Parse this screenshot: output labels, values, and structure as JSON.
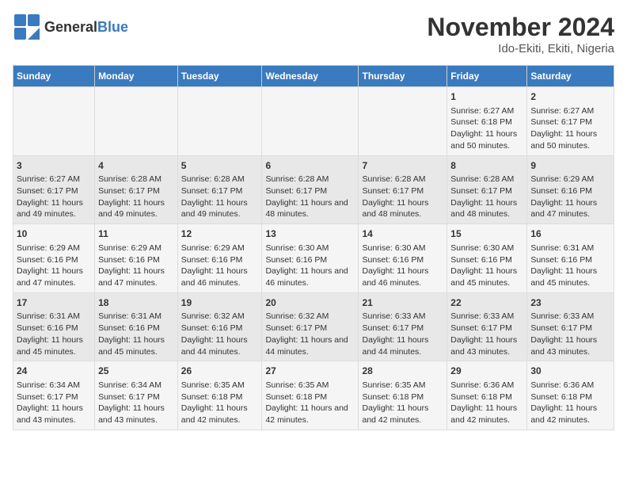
{
  "header": {
    "logo_general": "General",
    "logo_blue": "Blue",
    "title": "November 2024",
    "subtitle": "Ido-Ekiti, Ekiti, Nigeria"
  },
  "days_of_week": [
    "Sunday",
    "Monday",
    "Tuesday",
    "Wednesday",
    "Thursday",
    "Friday",
    "Saturday"
  ],
  "weeks": [
    {
      "cells": [
        {
          "day": "",
          "detail": ""
        },
        {
          "day": "",
          "detail": ""
        },
        {
          "day": "",
          "detail": ""
        },
        {
          "day": "",
          "detail": ""
        },
        {
          "day": "",
          "detail": ""
        },
        {
          "day": "1",
          "detail": "Sunrise: 6:27 AM\nSunset: 6:18 PM\nDaylight: 11 hours and 50 minutes."
        },
        {
          "day": "2",
          "detail": "Sunrise: 6:27 AM\nSunset: 6:17 PM\nDaylight: 11 hours and 50 minutes."
        }
      ]
    },
    {
      "cells": [
        {
          "day": "3",
          "detail": "Sunrise: 6:27 AM\nSunset: 6:17 PM\nDaylight: 11 hours and 49 minutes."
        },
        {
          "day": "4",
          "detail": "Sunrise: 6:28 AM\nSunset: 6:17 PM\nDaylight: 11 hours and 49 minutes."
        },
        {
          "day": "5",
          "detail": "Sunrise: 6:28 AM\nSunset: 6:17 PM\nDaylight: 11 hours and 49 minutes."
        },
        {
          "day": "6",
          "detail": "Sunrise: 6:28 AM\nSunset: 6:17 PM\nDaylight: 11 hours and 48 minutes."
        },
        {
          "day": "7",
          "detail": "Sunrise: 6:28 AM\nSunset: 6:17 PM\nDaylight: 11 hours and 48 minutes."
        },
        {
          "day": "8",
          "detail": "Sunrise: 6:28 AM\nSunset: 6:17 PM\nDaylight: 11 hours and 48 minutes."
        },
        {
          "day": "9",
          "detail": "Sunrise: 6:29 AM\nSunset: 6:16 PM\nDaylight: 11 hours and 47 minutes."
        }
      ]
    },
    {
      "cells": [
        {
          "day": "10",
          "detail": "Sunrise: 6:29 AM\nSunset: 6:16 PM\nDaylight: 11 hours and 47 minutes."
        },
        {
          "day": "11",
          "detail": "Sunrise: 6:29 AM\nSunset: 6:16 PM\nDaylight: 11 hours and 47 minutes."
        },
        {
          "day": "12",
          "detail": "Sunrise: 6:29 AM\nSunset: 6:16 PM\nDaylight: 11 hours and 46 minutes."
        },
        {
          "day": "13",
          "detail": "Sunrise: 6:30 AM\nSunset: 6:16 PM\nDaylight: 11 hours and 46 minutes."
        },
        {
          "day": "14",
          "detail": "Sunrise: 6:30 AM\nSunset: 6:16 PM\nDaylight: 11 hours and 46 minutes."
        },
        {
          "day": "15",
          "detail": "Sunrise: 6:30 AM\nSunset: 6:16 PM\nDaylight: 11 hours and 45 minutes."
        },
        {
          "day": "16",
          "detail": "Sunrise: 6:31 AM\nSunset: 6:16 PM\nDaylight: 11 hours and 45 minutes."
        }
      ]
    },
    {
      "cells": [
        {
          "day": "17",
          "detail": "Sunrise: 6:31 AM\nSunset: 6:16 PM\nDaylight: 11 hours and 45 minutes."
        },
        {
          "day": "18",
          "detail": "Sunrise: 6:31 AM\nSunset: 6:16 PM\nDaylight: 11 hours and 45 minutes."
        },
        {
          "day": "19",
          "detail": "Sunrise: 6:32 AM\nSunset: 6:16 PM\nDaylight: 11 hours and 44 minutes."
        },
        {
          "day": "20",
          "detail": "Sunrise: 6:32 AM\nSunset: 6:17 PM\nDaylight: 11 hours and 44 minutes."
        },
        {
          "day": "21",
          "detail": "Sunrise: 6:33 AM\nSunset: 6:17 PM\nDaylight: 11 hours and 44 minutes."
        },
        {
          "day": "22",
          "detail": "Sunrise: 6:33 AM\nSunset: 6:17 PM\nDaylight: 11 hours and 43 minutes."
        },
        {
          "day": "23",
          "detail": "Sunrise: 6:33 AM\nSunset: 6:17 PM\nDaylight: 11 hours and 43 minutes."
        }
      ]
    },
    {
      "cells": [
        {
          "day": "24",
          "detail": "Sunrise: 6:34 AM\nSunset: 6:17 PM\nDaylight: 11 hours and 43 minutes."
        },
        {
          "day": "25",
          "detail": "Sunrise: 6:34 AM\nSunset: 6:17 PM\nDaylight: 11 hours and 43 minutes."
        },
        {
          "day": "26",
          "detail": "Sunrise: 6:35 AM\nSunset: 6:18 PM\nDaylight: 11 hours and 42 minutes."
        },
        {
          "day": "27",
          "detail": "Sunrise: 6:35 AM\nSunset: 6:18 PM\nDaylight: 11 hours and 42 minutes."
        },
        {
          "day": "28",
          "detail": "Sunrise: 6:35 AM\nSunset: 6:18 PM\nDaylight: 11 hours and 42 minutes."
        },
        {
          "day": "29",
          "detail": "Sunrise: 6:36 AM\nSunset: 6:18 PM\nDaylight: 11 hours and 42 minutes."
        },
        {
          "day": "30",
          "detail": "Sunrise: 6:36 AM\nSunset: 6:18 PM\nDaylight: 11 hours and 42 minutes."
        }
      ]
    }
  ]
}
